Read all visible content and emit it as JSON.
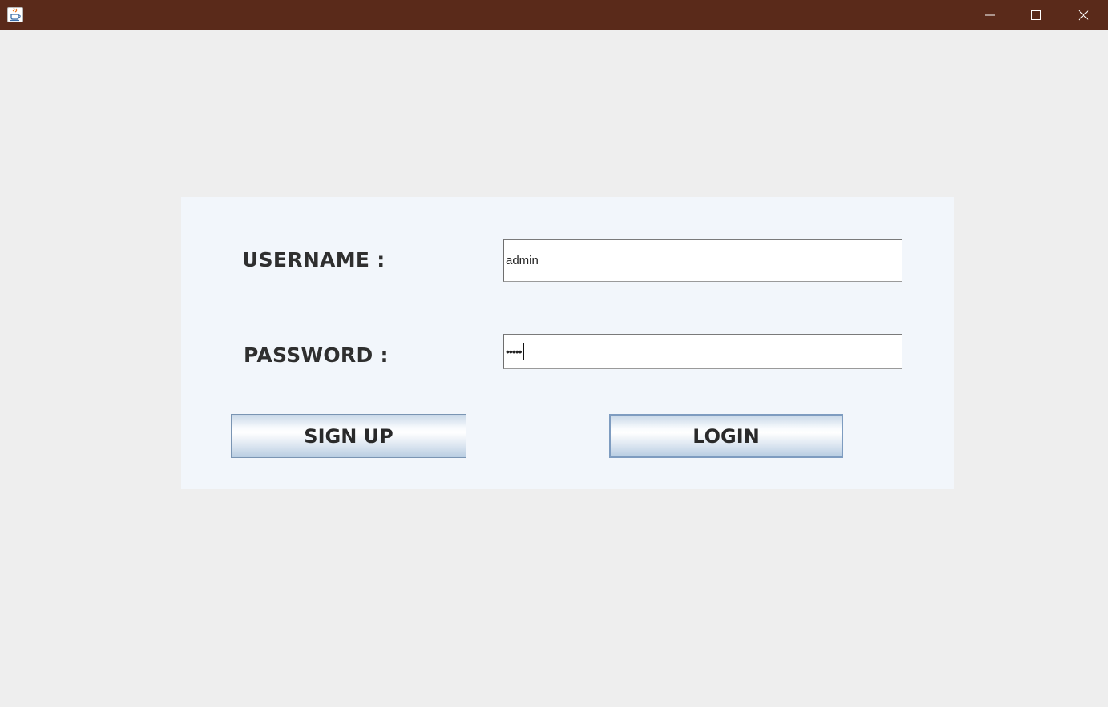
{
  "window": {
    "title": "",
    "controls": {
      "minimize": "minimize-icon",
      "maximize": "maximize-icon",
      "close": "close-icon"
    },
    "titlebar_color": "#5a2a1a"
  },
  "form": {
    "username_label": "USERNAME :",
    "username_value": "admin",
    "password_label": "PASSWORD :",
    "password_masked": "•••••",
    "signup_label": "SIGN UP",
    "login_label": "LOGIN"
  }
}
